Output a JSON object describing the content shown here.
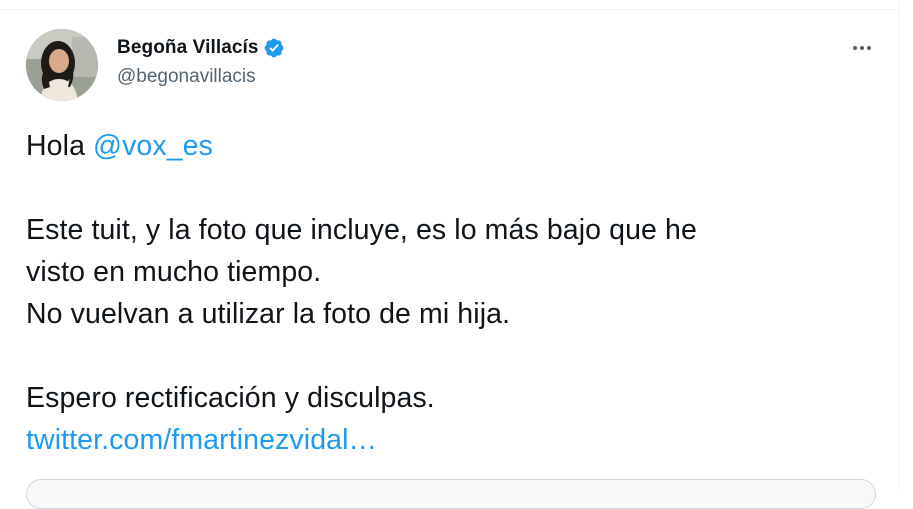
{
  "author": {
    "name": "Begoña Villacís",
    "handle": "@begonavillacis",
    "verified_color": "#1d9bf0"
  },
  "tweet": {
    "line1_prefix": "Hola ",
    "line1_mention": "@vox_es",
    "line2": "Este tuit, y la foto que incluye, es lo más bajo que he",
    "line3": "visto en mucho tiempo.",
    "line4": "No vuelvan a utilizar la foto de mi hija.",
    "line5": "Espero rectificación y disculpas.",
    "link": "twitter.com/fmartinezvidal…"
  },
  "icons": {
    "verified": "verified-badge-icon",
    "more": "more-options-icon"
  },
  "colors": {
    "text": "#0f1419",
    "secondary": "#536471",
    "accent": "#1d9bf0"
  }
}
